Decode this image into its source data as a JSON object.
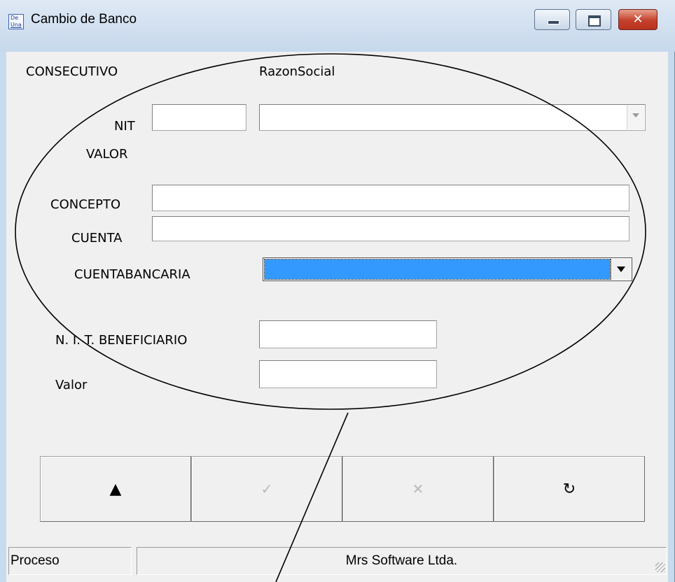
{
  "window": {
    "title": "Cambio de Banco",
    "icon_text_top": "De",
    "icon_text_bottom": "Una",
    "controls": [
      "minimize-icon",
      "maximize-icon",
      "close-icon"
    ],
    "close_glyph": "✕"
  },
  "form": {
    "consecutivo_label": "CONSECUTIVO",
    "razon_social_label": "RazonSocial",
    "nit_label": "NIT",
    "nit_value": "",
    "razon_social_value": "",
    "valor_label": "VALOR",
    "concepto_label": "CONCEPTO",
    "concepto_value": "",
    "cuenta_label": "CUENTA",
    "cuenta_value": "",
    "cuenta_bancaria_label": "CUENTABANCARIA",
    "cuenta_bancaria_value": "",
    "nit_beneficiario_label": "N. I. T. BENEFICIARIO",
    "nit_beneficiario_value": "",
    "valor2_label": "Valor",
    "valor2_value": ""
  },
  "actions": [
    {
      "name": "up-arrow-icon",
      "glyph": "▲",
      "enabled": true
    },
    {
      "name": "check-icon",
      "glyph": "✓",
      "enabled": false
    },
    {
      "name": "cancel-x-icon",
      "glyph": "✕",
      "enabled": false
    },
    {
      "name": "refresh-icon",
      "glyph": "↻",
      "enabled": true
    }
  ],
  "status": {
    "panel1": "Proceso",
    "panel2": "Mrs Software Ltda."
  },
  "colors": {
    "selection": "#3399ff",
    "client_bg": "#f0f0f0",
    "close_button": "#c4402c"
  }
}
